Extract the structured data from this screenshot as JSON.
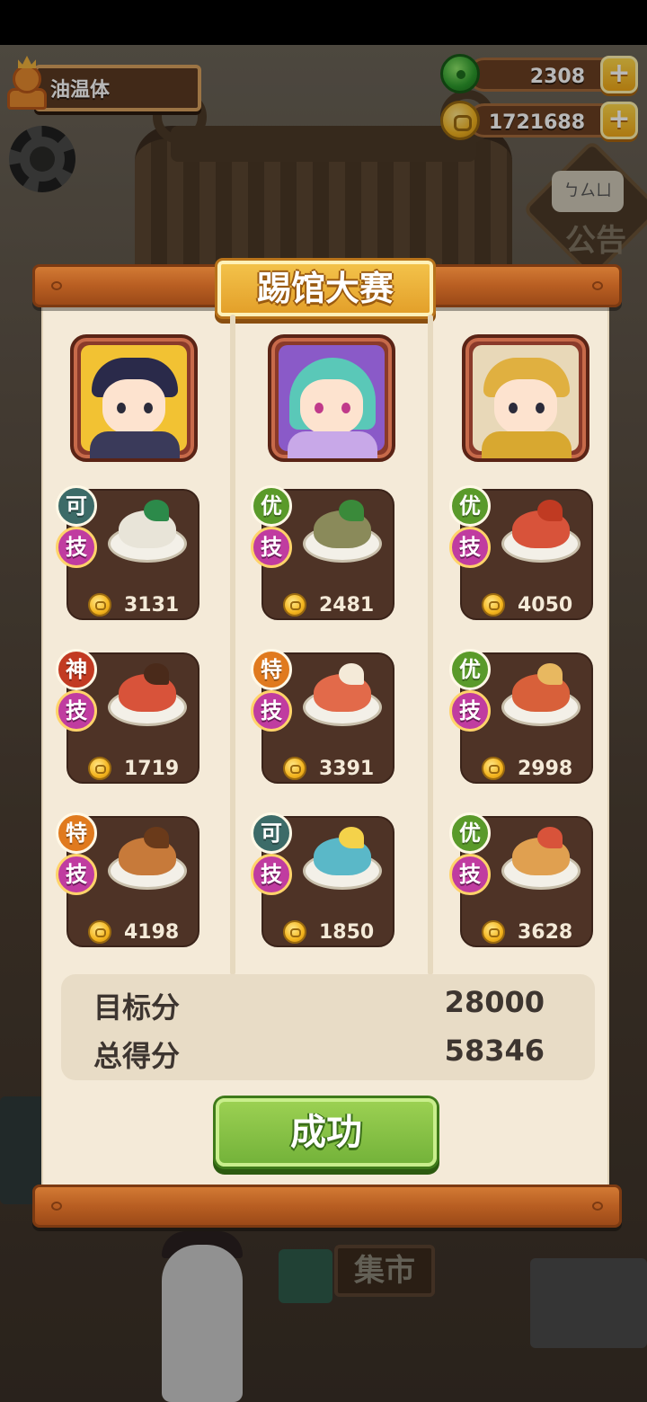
{
  "player": {
    "name": "油温体"
  },
  "currencies": [
    {
      "icon": "jade-icon",
      "value": "2308"
    },
    {
      "icon": "coin-icon",
      "value": "1721688"
    }
  ],
  "plus_label": "+",
  "background": {
    "notice_label": "公告",
    "market_sign": "集市"
  },
  "panel": {
    "title": "踢馆大赛",
    "skill_label": "技",
    "columns": [
      {
        "portrait": "official-portrait",
        "dishes": [
          {
            "grade": "可",
            "grade_color": "#3c6b68",
            "price": "3131",
            "food_color": "#e8e4d8",
            "garnish_color": "#2c8a4a"
          },
          {
            "grade": "神",
            "grade_color": "#c23a22",
            "price": "1719",
            "food_color": "#d8533a",
            "garnish_color": "#4a2a1a"
          },
          {
            "grade": "特",
            "grade_color": "#e07a1e",
            "price": "4198",
            "food_color": "#c77a3a",
            "garnish_color": "#6a3a1a"
          }
        ]
      },
      {
        "portrait": "teal-hair-girl-portrait",
        "dishes": [
          {
            "grade": "优",
            "grade_color": "#5a9a2a",
            "price": "2481",
            "food_color": "#8a8a5a",
            "garnish_color": "#3a8a3a"
          },
          {
            "grade": "特",
            "grade_color": "#e07a1e",
            "price": "3391",
            "food_color": "#e26a4a",
            "garnish_color": "#f4ead8"
          },
          {
            "grade": "可",
            "grade_color": "#3c6b68",
            "price": "1850",
            "food_color": "#5ab8c8",
            "garnish_color": "#f4d24a"
          }
        ]
      },
      {
        "portrait": "empress-portrait",
        "dishes": [
          {
            "grade": "优",
            "grade_color": "#5a9a2a",
            "price": "4050",
            "food_color": "#d8533a",
            "garnish_color": "#c03a22"
          },
          {
            "grade": "优",
            "grade_color": "#5a9a2a",
            "price": "2998",
            "food_color": "#d8603a",
            "garnish_color": "#e8b860"
          },
          {
            "grade": "优",
            "grade_color": "#5a9a2a",
            "price": "3628",
            "food_color": "#e0a050",
            "garnish_color": "#d8533a"
          }
        ]
      }
    ],
    "target_label": "目标分",
    "target_value": "28000",
    "total_label": "总得分",
    "total_value": "58346",
    "result_label": "成功"
  }
}
